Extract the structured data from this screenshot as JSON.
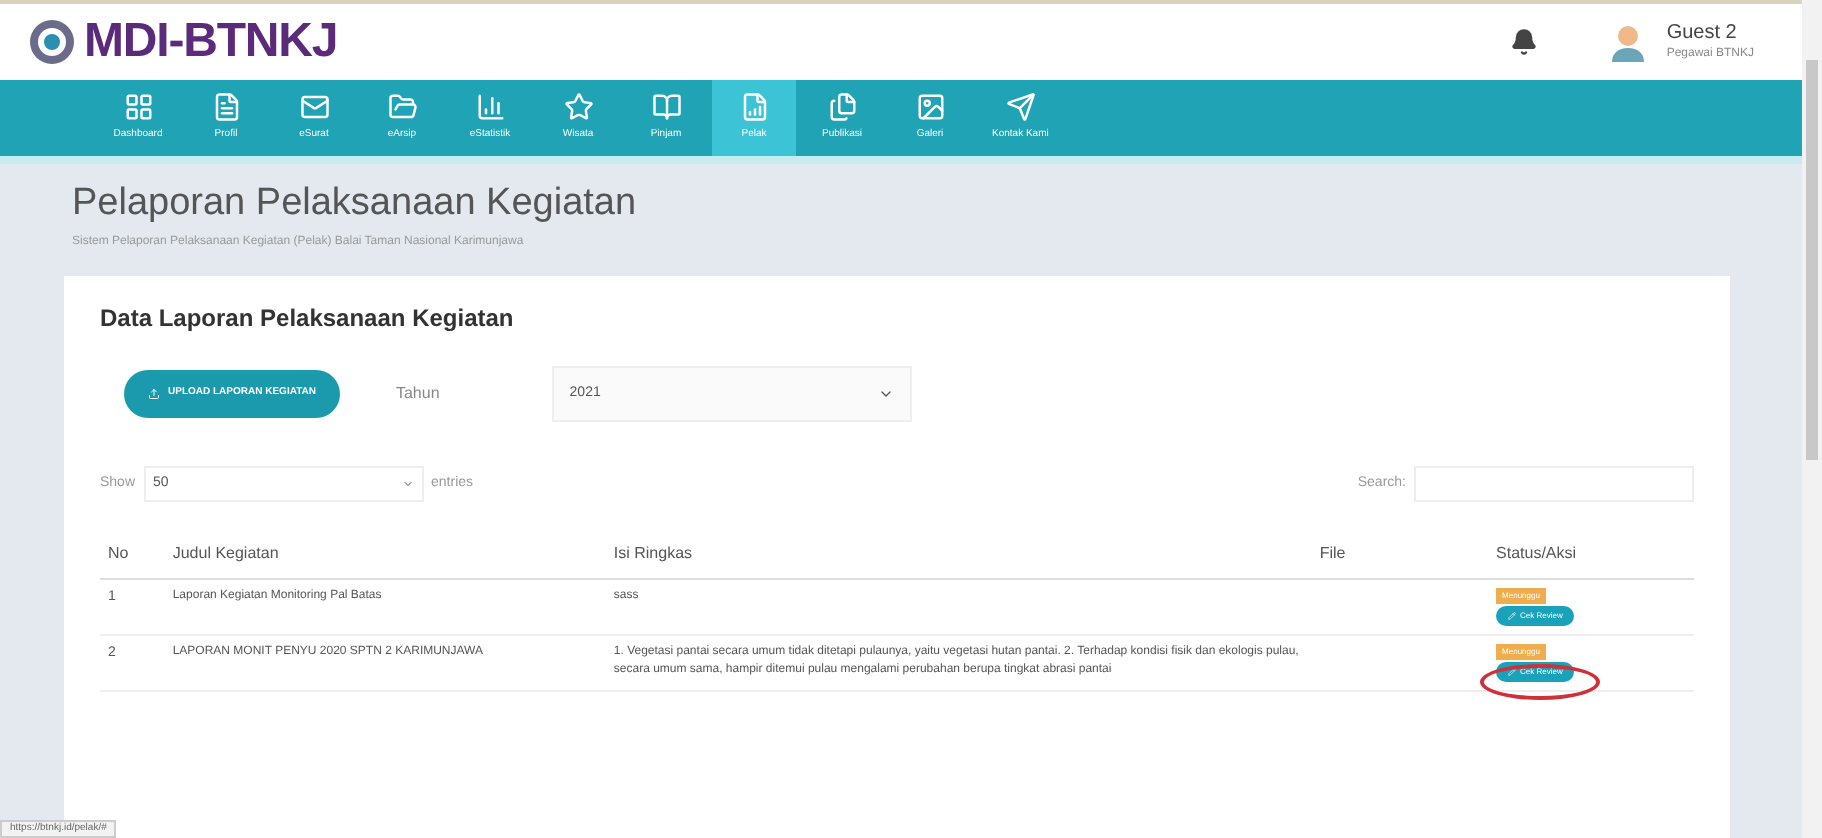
{
  "header": {
    "logo": "MDI-BTNKJ",
    "user": {
      "name": "Guest 2",
      "role": "Pegawai BTNKJ"
    }
  },
  "nav": [
    {
      "label": "Dashboard",
      "selected": false
    },
    {
      "label": "Profil",
      "selected": false
    },
    {
      "label": "eSurat",
      "selected": false
    },
    {
      "label": "eArsip",
      "selected": false
    },
    {
      "label": "eStatistik",
      "selected": false
    },
    {
      "label": "Wisata",
      "selected": false
    },
    {
      "label": "Pinjam",
      "selected": false
    },
    {
      "label": "Pelak",
      "selected": true
    },
    {
      "label": "Publikasi",
      "selected": false
    },
    {
      "label": "Galeri",
      "selected": false
    },
    {
      "label": "Kontak Kami",
      "selected": false
    }
  ],
  "page": {
    "title": "Pelaporan Pelaksanaan Kegiatan",
    "subtitle": "Sistem Pelaporan Pelaksanaan Kegiatan (Pelak) Balai Taman Nasional Karimunjawa"
  },
  "card": {
    "title": "Data Laporan Pelaksanaan Kegiatan",
    "upload_button": "UPLOAD LAPORAN KEGIATAN",
    "year_label": "Tahun",
    "year": "2021",
    "show_label": "Show",
    "entries_value": "50",
    "entries_label": "entries",
    "search_label": "Search:",
    "table": {
      "columns": [
        "No",
        "Judul Kegiatan",
        "Isi Ringkas",
        "File",
        "Status/Aksi"
      ],
      "rows": [
        {
          "no": "1",
          "title": "Laporan Kegiatan Monitoring Pal Batas",
          "summary": "sass",
          "status": "Menunggu",
          "action": "Cek Review",
          "highlighted": false
        },
        {
          "no": "2",
          "title": "LAPORAN MONIT PENYU 2020 SPTN 2 KARIMUNJAWA",
          "summary": "1. Vegetasi pantai secara umum tidak ditetapi pulaunya, yaitu vegetasi hutan pantai. 2. Terhadap kondisi fisik dan ekologis pulau, secara umum sama, hampir ditemui pulau mengalami perubahan berupa tingkat abrasi pantai",
          "status": "Menunggu",
          "action": "Cek Review",
          "highlighted": true
        }
      ]
    }
  },
  "status_bar": "https://btnkj.id/pelak/#"
}
